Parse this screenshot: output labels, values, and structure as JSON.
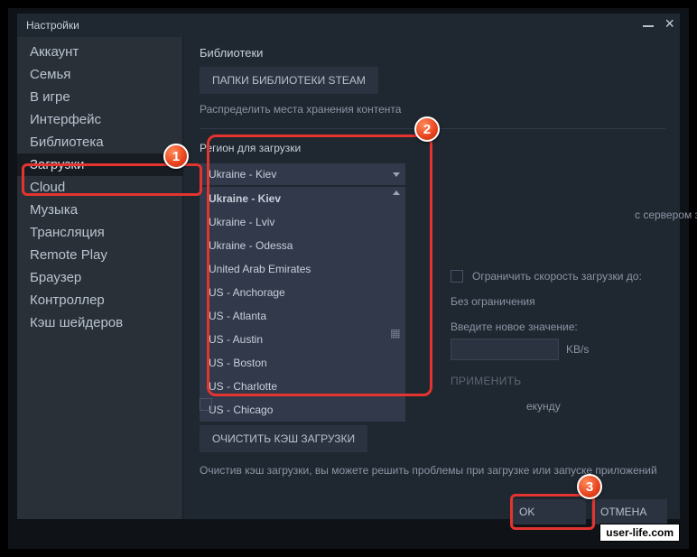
{
  "window": {
    "title": "Настройки"
  },
  "sidebar": {
    "items": [
      {
        "label": "Аккаунт"
      },
      {
        "label": "Семья"
      },
      {
        "label": "В игре"
      },
      {
        "label": "Интерфейс"
      },
      {
        "label": "Библиотека"
      },
      {
        "label": "Загрузки",
        "active": true
      },
      {
        "label": "Cloud"
      },
      {
        "label": "Музыка"
      },
      {
        "label": "Трансляция"
      },
      {
        "label": "Remote Play"
      },
      {
        "label": "Браузер"
      },
      {
        "label": "Контроллер"
      },
      {
        "label": "Кэш шейдеров"
      }
    ]
  },
  "libraries": {
    "heading": "Библиотеки",
    "button": "ПАПКИ БИБЛИОТЕКИ STEAM",
    "desc": "Распределить места хранения контента"
  },
  "region": {
    "heading": "Регион для загрузки",
    "selected": "Ukraine - Kiev",
    "options": [
      "Ukraine - Kiev",
      "Ukraine - Lviv",
      "Ukraine - Odessa",
      "United Arab Emirates",
      "US - Anchorage",
      "US - Atlanta",
      "US - Austin",
      "US - Boston",
      "US - Charlotte",
      "US - Chicago"
    ],
    "note": "с сервером загрузок, но его можно изменить"
  },
  "limits": {
    "limit_label": "Ограничить скорость загрузки до:",
    "no_limit": "Без ограничения",
    "new_value_label": "Введите новое значение:",
    "unit": "KB/s",
    "apply": "ПРИМЕНИТЬ"
  },
  "stray": {
    "text": "екунду"
  },
  "cache": {
    "button": "ОЧИСТИТЬ КЭШ ЗАГРУЗКИ",
    "note": "Очистив кэш загрузки, вы можете решить проблемы при загрузке или запуске приложений"
  },
  "dialog": {
    "ok": "OK",
    "cancel": "ОТМЕНА"
  },
  "annotations": {
    "b1": "1",
    "b2": "2",
    "b3": "3"
  },
  "watermark": "user-life.com"
}
